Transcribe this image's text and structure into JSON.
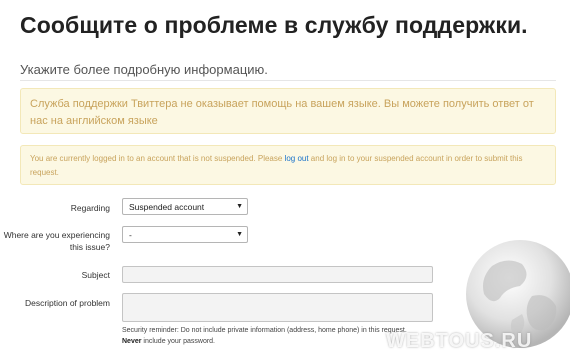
{
  "page": {
    "title": "Сообщите о проблеме в службу поддержки.",
    "subtitle": "Укажите более подробную информацию."
  },
  "alerts": {
    "language_notice": "Служба поддержки Твиттера не оказывает помощь на вашем языке. Вы можете получить ответ от нас на английском языке",
    "account_before": "You are currently logged in to an account that is not suspended. Please ",
    "account_link": "log out",
    "account_after": " and log in to your suspended account in order to submit this request."
  },
  "form": {
    "regarding_label": "Regarding",
    "regarding_value": "Suspended account",
    "issue_label": "Where are you experiencing this issue?",
    "issue_value": "-",
    "subject_label": "Subject",
    "description_label": "Description of problem",
    "reminder_text": "Security reminder: Do not include private information (address, home phone) in this request. ",
    "reminder_bold": "Never",
    "reminder_tail": " include your password."
  },
  "watermark": {
    "text": "WEBTOUS.RU"
  },
  "colors": {
    "alert_bg": "#fcf8e3",
    "alert_text": "#c8a35c",
    "link": "#1a73c9"
  }
}
